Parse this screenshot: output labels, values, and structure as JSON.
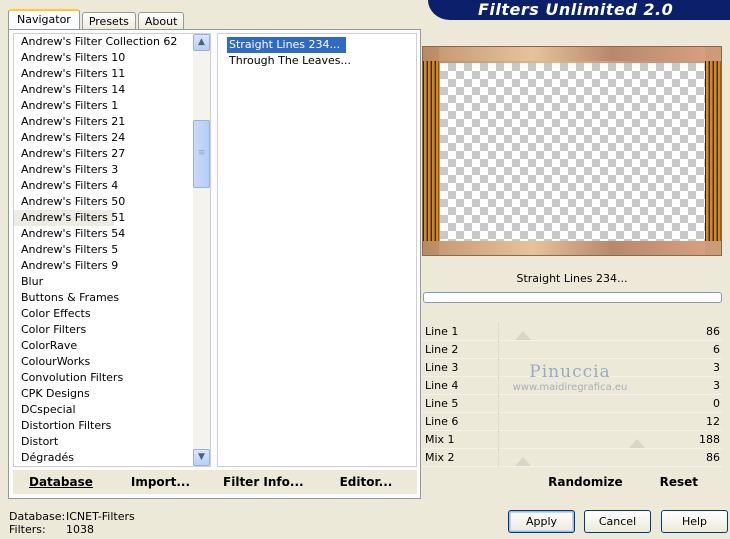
{
  "banner": {
    "title": "Filters Unlimited 2.0"
  },
  "tabs": [
    {
      "label": "Navigator",
      "active": true
    },
    {
      "label": "Presets",
      "active": false
    },
    {
      "label": "About",
      "active": false
    }
  ],
  "categories": {
    "selected": "Andrew's Filters 51",
    "items": [
      "Andrew's Filter Collection 62",
      "Andrew's Filters 10",
      "Andrew's Filters 11",
      "Andrew's Filters 14",
      "Andrew's Filters 1",
      "Andrew's Filters 21",
      "Andrew's Filters 24",
      "Andrew's Filters 27",
      "Andrew's Filters 3",
      "Andrew's Filters 4",
      "Andrew's Filters 50",
      "Andrew's Filters 51",
      "Andrew's Filters 54",
      "Andrew's Filters 5",
      "Andrew's Filters 9",
      "Blur",
      "Buttons & Frames",
      "Color Effects",
      "Color Filters",
      "ColorRave",
      "ColourWorks",
      "Convolution Filters",
      "CPK Designs",
      "DCspecial",
      "Distortion Filters",
      "Distort",
      "Dégradés"
    ]
  },
  "filters": {
    "selected": "Straight Lines 234...",
    "items": [
      "Straight Lines 234...",
      "Through The Leaves..."
    ]
  },
  "toolbar_left": {
    "database": "Database",
    "import": "Import...",
    "filter_info": "Filter Info...",
    "editor": "Editor..."
  },
  "preview": {
    "filter_name": "Straight Lines 234..."
  },
  "params": [
    {
      "label": "Line 1",
      "value": "86"
    },
    {
      "label": "Line 2",
      "value": "6"
    },
    {
      "label": "Line 3",
      "value": "3"
    },
    {
      "label": "Line 4",
      "value": "3"
    },
    {
      "label": "Line 5",
      "value": "0"
    },
    {
      "label": "Line 6",
      "value": "12"
    },
    {
      "label": "Mix 1",
      "value": "188"
    },
    {
      "label": "Mix 2",
      "value": "86"
    }
  ],
  "watermark": {
    "title": "Pinuccia",
    "url": "www.maidiregrafica.eu"
  },
  "toolbar_right": {
    "randomize": "Randomize",
    "reset": "Reset"
  },
  "footer": {
    "database_label": "Database:",
    "database_value": "ICNET-Filters",
    "filters_label": "Filters:",
    "filters_value": "1038"
  },
  "dialog_buttons": {
    "apply": "Apply",
    "cancel": "Cancel",
    "help": "Help"
  }
}
